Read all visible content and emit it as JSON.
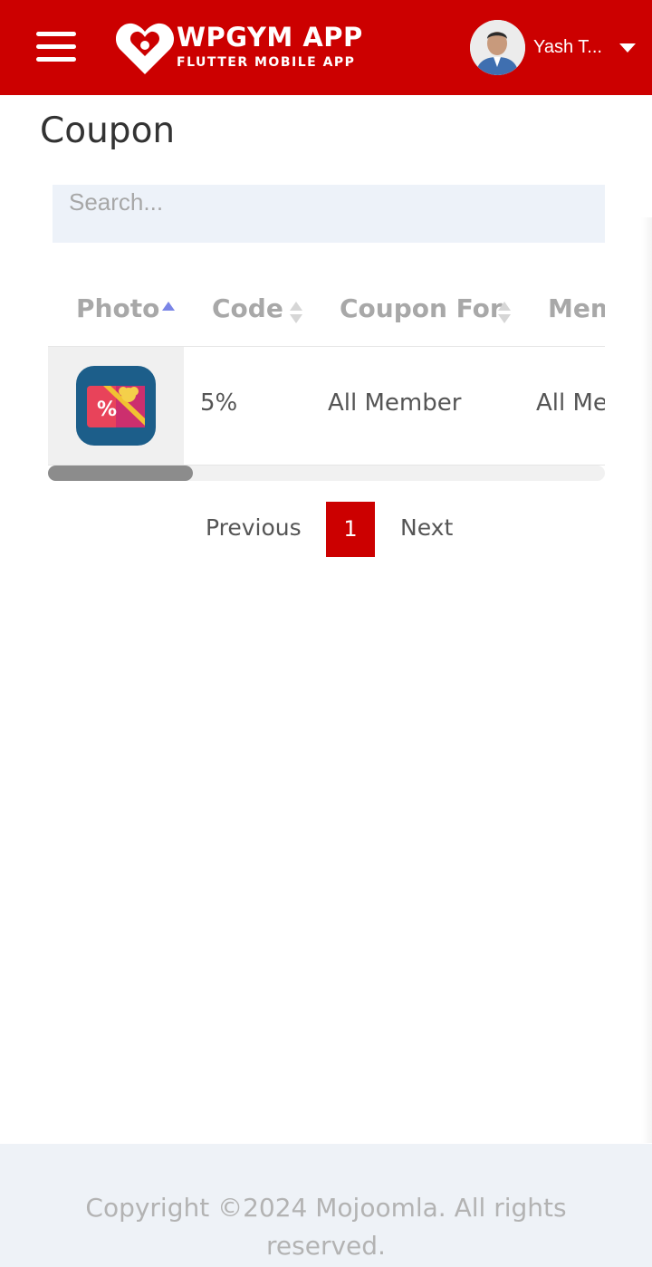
{
  "header": {
    "app_title": "WPGYM APP",
    "app_subtitle": "FLUTTER MOBILE APP",
    "user_name": "Yash T...",
    "brand_color": "#cc0000"
  },
  "page": {
    "title": "Coupon"
  },
  "search": {
    "placeholder": "Search..."
  },
  "table": {
    "columns": [
      "Photo",
      "Code",
      "Coupon For",
      "Mem"
    ],
    "rows": [
      {
        "photo_icon": "coupon-icon",
        "code": "5%",
        "coupon_for": "All Member",
        "membership": "All Me"
      }
    ],
    "horizontal_scroll_fraction": 0.26
  },
  "pagination": {
    "previous_label": "Previous",
    "current_page": "1",
    "next_label": "Next"
  },
  "footer": {
    "copyright": "Copyright ©2024 Mojoomla. All rights reserved."
  }
}
